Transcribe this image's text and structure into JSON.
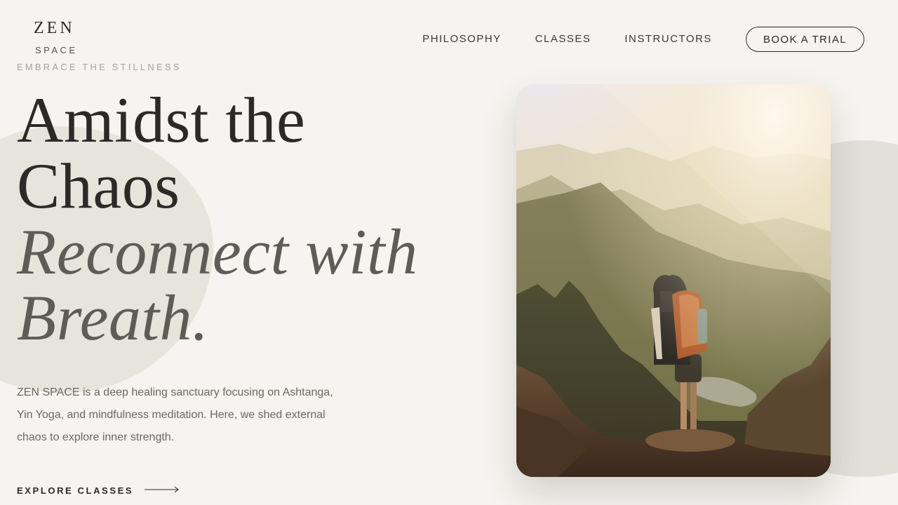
{
  "brand": {
    "name": "ZEN",
    "sub": "SPACE",
    "tagline": "EMBRACE THE STILLNESS"
  },
  "nav": {
    "items": [
      "PHILOSOPHY",
      "CLASSES",
      "INSTRUCTORS"
    ],
    "cta": "BOOK A TRIAL"
  },
  "hero": {
    "line1": "Amidst the",
    "line2": "Chaos",
    "line3": "Reconnect with",
    "line4": "Breath.",
    "description": "ZEN SPACE is a deep healing sanctuary focusing on Ashtanga, Yin Yoga, and mindfulness meditation. Here, we shed external chaos to explore inner strength.",
    "explore_label": "EXPLORE CLASSES",
    "explore_icon": "arrow-right-icon"
  },
  "colors": {
    "background": "#f6f4f0",
    "text": "#2b2a27",
    "accent_blob": "#e7e4dc"
  }
}
